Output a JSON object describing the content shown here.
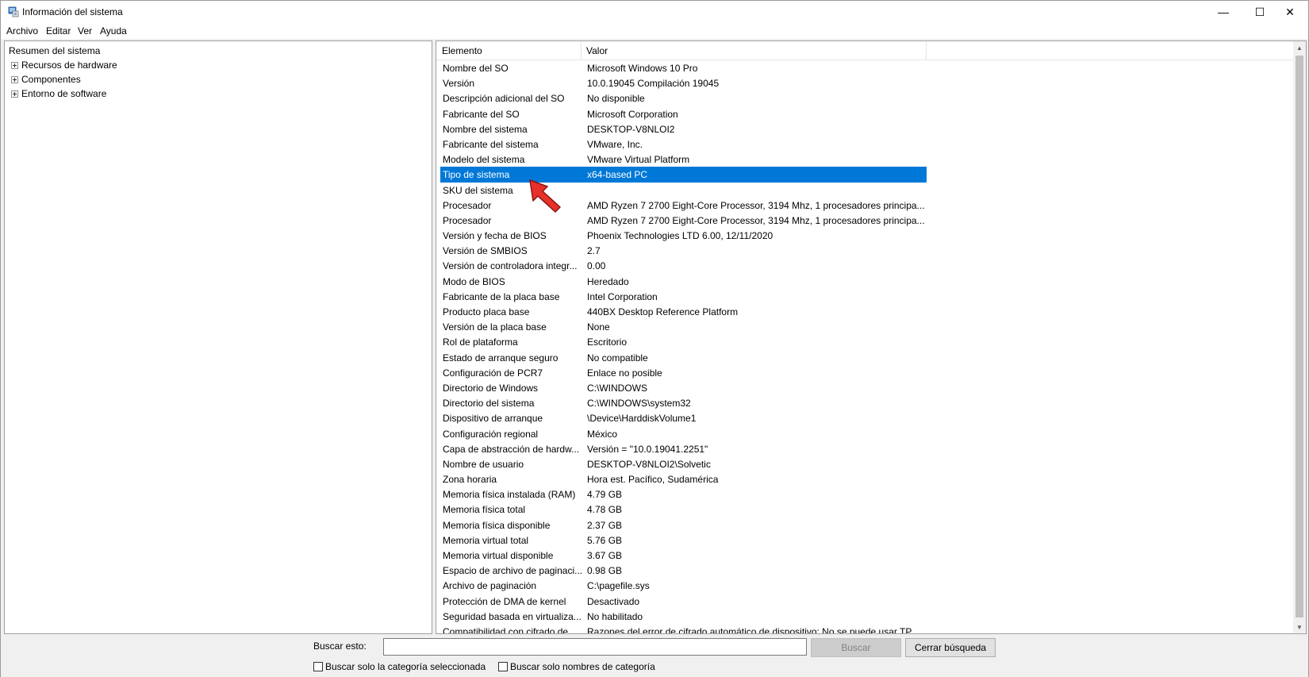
{
  "window": {
    "title": "Información del sistema",
    "controls": {
      "minimize": "—",
      "maximize": "☐",
      "close": "✕"
    }
  },
  "menu": [
    "Archivo",
    "Editar",
    "Ver",
    "Ayuda"
  ],
  "tree": {
    "root": "Resumen del sistema",
    "nodes": [
      "Recursos de hardware",
      "Componentes",
      "Entorno de software"
    ]
  },
  "list": {
    "headers": {
      "item": "Elemento",
      "value": "Valor"
    },
    "selected_index": 7,
    "rows": [
      [
        "Nombre del SO",
        "Microsoft Windows 10 Pro"
      ],
      [
        "Versión",
        "10.0.19045 Compilación 19045"
      ],
      [
        "Descripción adicional del SO",
        "No disponible"
      ],
      [
        "Fabricante del SO",
        "Microsoft Corporation"
      ],
      [
        "Nombre del sistema",
        "DESKTOP-V8NLOI2"
      ],
      [
        "Fabricante del sistema",
        "VMware, Inc."
      ],
      [
        "Modelo del sistema",
        "VMware Virtual Platform"
      ],
      [
        "Tipo de sistema",
        "x64-based PC"
      ],
      [
        "SKU del sistema",
        ""
      ],
      [
        "Procesador",
        "AMD Ryzen 7 2700 Eight-Core Processor, 3194 Mhz, 1 procesadores principa..."
      ],
      [
        "Procesador",
        "AMD Ryzen 7 2700 Eight-Core Processor, 3194 Mhz, 1 procesadores principa..."
      ],
      [
        "Versión y fecha de BIOS",
        "Phoenix Technologies LTD 6.00, 12/11/2020"
      ],
      [
        "Versión de SMBIOS",
        "2.7"
      ],
      [
        "Versión de controladora integr...",
        "0.00"
      ],
      [
        "Modo de BIOS",
        "Heredado"
      ],
      [
        "Fabricante de la placa base",
        "Intel Corporation"
      ],
      [
        "Producto placa base",
        "440BX Desktop Reference Platform"
      ],
      [
        "Versión de la placa base",
        "None"
      ],
      [
        "Rol de plataforma",
        "Escritorio"
      ],
      [
        "Estado de arranque seguro",
        "No compatible"
      ],
      [
        "Configuración de PCR7",
        "Enlace no posible"
      ],
      [
        "Directorio de Windows",
        "C:\\WINDOWS"
      ],
      [
        "Directorio del sistema",
        "C:\\WINDOWS\\system32"
      ],
      [
        "Dispositivo de arranque",
        "\\Device\\HarddiskVolume1"
      ],
      [
        "Configuración regional",
        "México"
      ],
      [
        "Capa de abstracción de hardw...",
        "Versión = \"10.0.19041.2251\""
      ],
      [
        "Nombre de usuario",
        "DESKTOP-V8NLOI2\\Solvetic"
      ],
      [
        "Zona horaria",
        "Hora est. Pacífico, Sudamérica"
      ],
      [
        "Memoria física instalada (RAM)",
        "4.79 GB"
      ],
      [
        "Memoria física total",
        "4.78 GB"
      ],
      [
        "Memoria física disponible",
        "2.37 GB"
      ],
      [
        "Memoria virtual total",
        "5.76 GB"
      ],
      [
        "Memoria virtual disponible",
        "3.67 GB"
      ],
      [
        "Espacio de archivo de paginaci...",
        "0.98 GB"
      ],
      [
        "Archivo de paginación",
        "C:\\pagefile.sys"
      ],
      [
        "Protección de DMA de kernel",
        "Desactivado"
      ],
      [
        "Seguridad basada en virtualiza...",
        "No habilitado"
      ],
      [
        "Compatibilidad con cifrado de...",
        "Razones del error de cifrado automático de dispositivo: No se puede usar TP..."
      ]
    ]
  },
  "search": {
    "label": "Buscar esto:",
    "value": "",
    "search_button": "Buscar",
    "close_button": "Cerrar búsqueda",
    "option_selected_category": "Buscar solo la categoría seleccionada",
    "option_category_names": "Buscar solo nombres de categoría"
  },
  "colors": {
    "selection": "#0078d7",
    "annotation_arrow": "#e8302a"
  }
}
